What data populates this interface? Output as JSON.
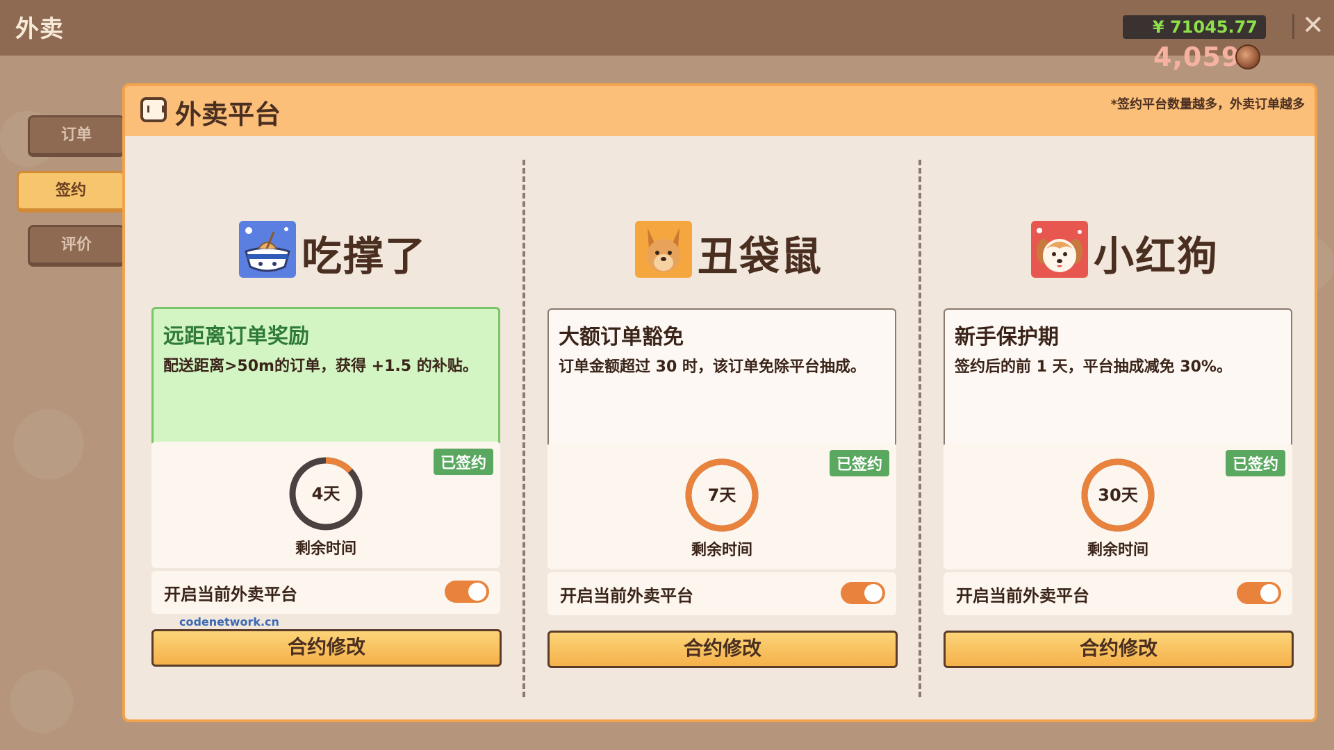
{
  "app": {
    "title": "外卖",
    "money": "¥ 71045.77",
    "coins": "4,059",
    "close_label": "✕"
  },
  "side_tabs": [
    {
      "label": "订单",
      "active": false
    },
    {
      "label": "签约",
      "active": true
    },
    {
      "label": "评价",
      "active": false
    }
  ],
  "panel": {
    "title": "外卖平台",
    "note": "*签约平台数量越多，外卖订单越多"
  },
  "platforms": [
    {
      "name": "吃撑了",
      "logo_icon": "noodle-bowl-icon",
      "perk_title": "远距离订单奖励",
      "perk_desc": "配送距离>50m的订单，获得 +1.5 的补贴。",
      "highlighted": true,
      "badge": "已签约",
      "remaining": "4天",
      "remaining_fraction": 0.13,
      "remain_label": "剩余时间",
      "toggle_label": "开启当前外卖平台",
      "toggle_on": true,
      "button": "合约修改"
    },
    {
      "name": "丑袋鼠",
      "logo_icon": "kangaroo-icon",
      "perk_title": "大额订单豁免",
      "perk_desc": "订单金额超过 30 时，该订单免除平台抽成。",
      "highlighted": false,
      "badge": "已签约",
      "remaining": "7天",
      "remaining_fraction": 1.0,
      "remain_label": "剩余时间",
      "toggle_label": "开启当前外卖平台",
      "toggle_on": true,
      "button": "合约修改"
    },
    {
      "name": "小红狗",
      "logo_icon": "dog-icon",
      "perk_title": "新手保护期",
      "perk_desc": "签约后的前 1 天，平台抽成减免 30%。",
      "highlighted": false,
      "badge": "已签约",
      "remaining": "30天",
      "remaining_fraction": 1.0,
      "remain_label": "剩余时间",
      "toggle_label": "开启当前外卖平台",
      "toggle_on": true,
      "button": "合约修改"
    }
  ],
  "watermark": "codenetwork.cn",
  "colors": {
    "accent": "#f5b14a",
    "ring": "#e8823c",
    "ring_track": "#4a4240",
    "signed_badge": "#5aa860",
    "money_text": "#8ee04a"
  }
}
